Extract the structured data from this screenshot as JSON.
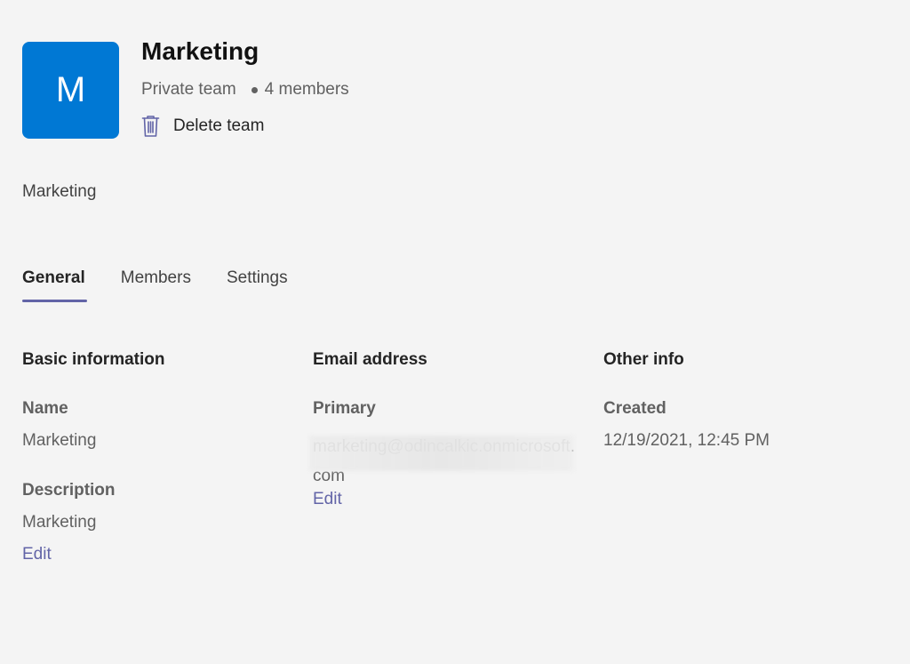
{
  "team": {
    "avatar_letter": "M",
    "avatar_color": "#0078d4",
    "name": "Marketing",
    "privacy": "Private team",
    "members_count": "4 members",
    "delete_label": "Delete team",
    "delete_icon": "trash-icon",
    "description": "Marketing"
  },
  "tabs": [
    {
      "label": "General",
      "active": true
    },
    {
      "label": "Members",
      "active": false
    },
    {
      "label": "Settings",
      "active": false
    }
  ],
  "accent_color": "#6264a7",
  "basic_info": {
    "title": "Basic information",
    "name_label": "Name",
    "name_value": "Marketing",
    "description_label": "Description",
    "description_value": "Marketing",
    "edit_label": "Edit"
  },
  "email": {
    "title": "Email address",
    "primary_label": "Primary",
    "primary_value": "marketing@odincalkic.onmicrosoft.com",
    "edit_label": "Edit"
  },
  "other_info": {
    "title": "Other info",
    "created_label": "Created",
    "created_value": "12/19/2021, 12:45 PM"
  }
}
